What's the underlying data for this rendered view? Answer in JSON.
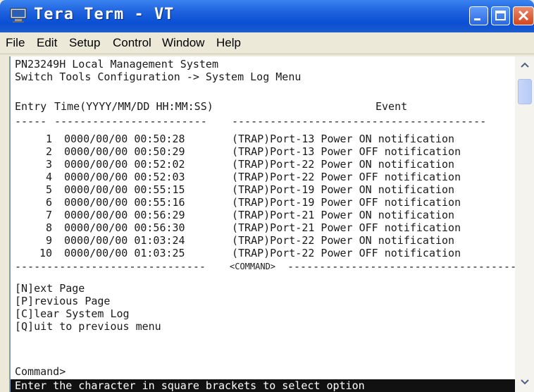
{
  "window": {
    "title": "Tera Term - VT"
  },
  "menu": [
    "File",
    "Edit",
    "Setup",
    "Control",
    "Window",
    "Help"
  ],
  "terminal": {
    "header1": "PN23249H Local Management System",
    "header2": "Switch Tools Configuration -> System Log Menu",
    "col_entry": "Entry",
    "col_time": "Time(YYYY/MM/DD HH:MM:SS)",
    "col_event": "Event",
    "dash_entry": "-----",
    "dash_time": "------------------------",
    "dash_event": "----------------------------------------",
    "rows": [
      {
        "entry": "1",
        "time": "0000/00/00 00:50:28",
        "event": "(TRAP)Port-13 Power ON notification"
      },
      {
        "entry": "2",
        "time": "0000/00/00 00:50:29",
        "event": "(TRAP)Port-13 Power OFF notification"
      },
      {
        "entry": "3",
        "time": "0000/00/00 00:52:02",
        "event": "(TRAP)Port-22 Power ON notification"
      },
      {
        "entry": "4",
        "time": "0000/00/00 00:52:03",
        "event": "(TRAP)Port-22 Power OFF notification"
      },
      {
        "entry": "5",
        "time": "0000/00/00 00:55:15",
        "event": "(TRAP)Port-19 Power ON notification"
      },
      {
        "entry": "6",
        "time": "0000/00/00 00:55:16",
        "event": "(TRAP)Port-19 Power OFF notification"
      },
      {
        "entry": "7",
        "time": "0000/00/00 00:56:29",
        "event": "(TRAP)Port-21 Power ON notification"
      },
      {
        "entry": "8",
        "time": "0000/00/00 00:56:30",
        "event": "(TRAP)Port-21 Power OFF notification"
      },
      {
        "entry": "9",
        "time": "0000/00/00 01:03:24",
        "event": "(TRAP)Port-22 Power ON notification"
      },
      {
        "entry": "10",
        "time": "0000/00/00 01:03:25",
        "event": "(TRAP)Port-22 Power OFF notification"
      }
    ],
    "command_divider_left": "------------------------------",
    "command_divider_label": "<COMMAND>",
    "command_divider_right": "---------------------------------------",
    "options": [
      "[N]ext Page",
      "[P]revious Page",
      "[C]lear System Log",
      "[Q]uit to previous menu"
    ],
    "prompt": "Command>",
    "status_line": "Enter the character in square brackets to select option"
  },
  "colors": {
    "titlebar": "#0b4fd4",
    "terminal_bg": "#ffffff",
    "terminal_text": "#1a1a1a",
    "status_bg": "#111111",
    "status_text": "#ffffff"
  },
  "icons": [
    "teraterm-app-icon",
    "minimize-icon",
    "maximize-icon",
    "close-icon",
    "scroll-up-icon",
    "scroll-down-icon"
  ]
}
